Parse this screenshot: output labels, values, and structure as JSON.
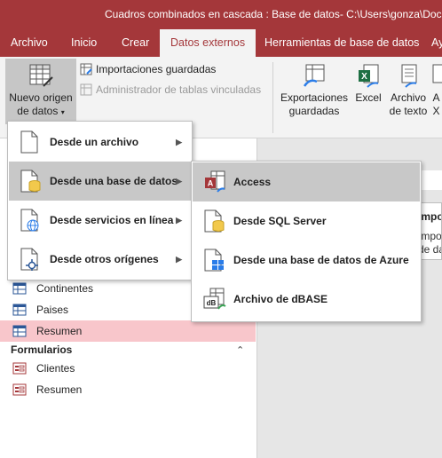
{
  "window": {
    "title": "Cuadros combinados en cascada : Base de datos- C:\\Users\\gonza\\Docu"
  },
  "tabs": [
    "Archivo",
    "Inicio",
    "Crear",
    "Datos externos",
    "Herramientas de base de datos",
    "Ay"
  ],
  "active_tab": "Datos externos",
  "ribbon": {
    "new_source": {
      "line1": "Nuevo origen",
      "line2": "de datos"
    },
    "saved_imports": "Importaciones guardadas",
    "linked_tables_manager": "Administrador de tablas vinculadas",
    "saved_exports": {
      "line1": "Exportaciones",
      "line2": "guardadas"
    },
    "excel": "Excel",
    "text_file": {
      "line1": "Archivo",
      "line2": "de texto"
    },
    "xml_partial": {
      "line1": "A",
      "line2": "X"
    }
  },
  "nav": {
    "tables": [
      "Continentes",
      "Paises",
      "Resumen"
    ],
    "selected_table": "Resumen",
    "forms_header": "Formularios",
    "forms": [
      "Clientes",
      "Resumen"
    ]
  },
  "menu": {
    "items": [
      "Desde un archivo",
      "Desde una base de datos",
      "Desde servicios en línea",
      "Desde otros orígenes"
    ],
    "hovered": "Desde una base de datos"
  },
  "submenu": {
    "items": [
      "Access",
      "Desde SQL Server",
      "Desde una base de datos de Azure",
      "Archivo de dBASE"
    ],
    "hovered": "Access"
  },
  "tooltip": {
    "title": "Impo",
    "line1": "Impo",
    "line2": "de da"
  },
  "colors": {
    "accent": "#a4373a",
    "selected_nav": "#f8c6cb",
    "menu_hover": "#c8c8c8"
  }
}
